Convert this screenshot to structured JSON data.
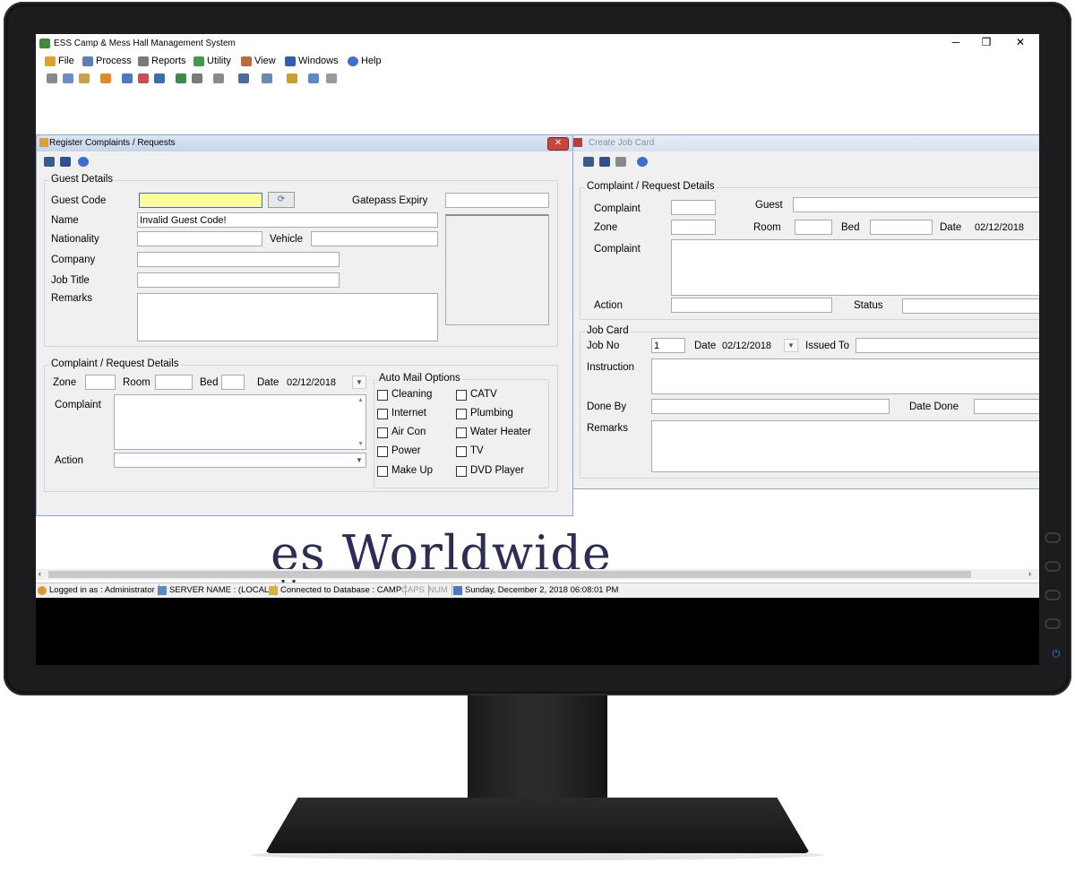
{
  "app": {
    "title": "ESS Camp & Mess Hall Management System",
    "controls": {
      "minimize": "─",
      "restore": "❐",
      "close": "✕"
    },
    "menu": [
      {
        "label": "File",
        "icon": "folder-icon",
        "color": "#e0a030"
      },
      {
        "label": "Process",
        "icon": "process-icon",
        "color": "#5a7fb0"
      },
      {
        "label": "Reports",
        "icon": "reports-icon",
        "color": "#7a7a7a"
      },
      {
        "label": "Utility",
        "icon": "utility-icon",
        "color": "#3d9a4a"
      },
      {
        "label": "View",
        "icon": "view-icon",
        "color": "#c0683a"
      },
      {
        "label": "Windows",
        "icon": "windows-icon",
        "color": "#2f5fb5"
      },
      {
        "label": "Help",
        "icon": "help-icon",
        "color": "#3b6fd0"
      }
    ]
  },
  "background_logo": {
    "text": "es Worldwide",
    "mark": "!!"
  },
  "statusbar": {
    "user": "Logged in as : Administrator",
    "server": "SERVER NAME : (LOCAL)",
    "database": "Connected to Database : CAMP",
    "caps": "CAPS",
    "num": "NUM",
    "datetime": "Sunday, December 2, 2018 06:08:01 PM"
  },
  "register": {
    "title": "Register Complaints / Requests",
    "guest_details": {
      "title": "Guest Details",
      "guest_code_label": "Guest Code",
      "guest_code_value": "",
      "gatepass_label": "Gatepass Expiry",
      "gatepass_value": "",
      "name_label": "Name",
      "name_value": "Invalid Guest Code!",
      "nationality_label": "Nationality",
      "vehicle_label": "Vehicle",
      "company_label": "Company",
      "job_title_label": "Job Title",
      "remarks_label": "Remarks"
    },
    "complaint_details": {
      "title": "Complaint / Request Details",
      "zone_label": "Zone",
      "room_label": "Room",
      "bed_label": "Bed",
      "date_label": "Date",
      "date_value": "02/12/2018",
      "complaint_label": "Complaint",
      "action_label": "Action"
    },
    "auto_mail": {
      "title": "Auto Mail Options",
      "left": [
        "Cleaning",
        "Internet",
        "Air Con",
        "Power",
        "Make Up"
      ],
      "right": [
        "CATV",
        "Plumbing",
        "Water Heater",
        "TV",
        "DVD Player"
      ]
    }
  },
  "jobcard": {
    "title": "Create Job Card",
    "details": {
      "title": "Complaint / Request Details",
      "complaint_label": "Complaint",
      "guest_label": "Guest",
      "zone_label": "Zone",
      "room_label": "Room",
      "bed_label": "Bed",
      "date_label": "Date",
      "date_value": "02/12/2018",
      "complaint2_label": "Complaint",
      "action_label": "Action",
      "status_label": "Status"
    },
    "job_card": {
      "title": "Job Card",
      "job_no_label": "Job No",
      "job_no_value": "1",
      "date_label": "Date",
      "date_value": "02/12/2018",
      "issued_to_label": "Issued To",
      "instruction_label": "Instruction",
      "done_by_label": "Done By",
      "date_done_label": "Date Done",
      "remarks_label": "Remarks"
    }
  }
}
